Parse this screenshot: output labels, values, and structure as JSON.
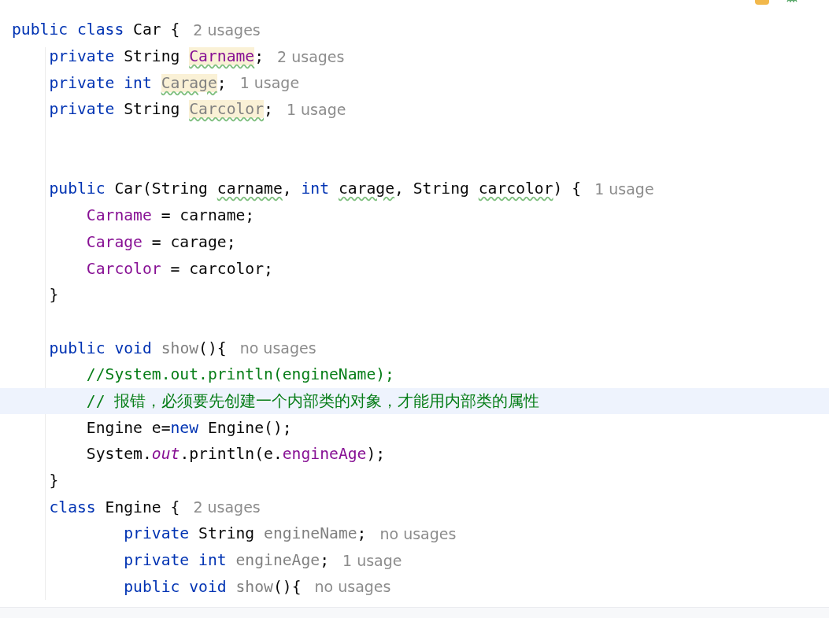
{
  "editor": {
    "lines": [
      {
        "current": false,
        "tokens": [
          {
            "kind": "keyword",
            "text": "public class "
          },
          {
            "kind": "plain",
            "text": "Car {"
          }
        ],
        "hint": "2 usages"
      },
      {
        "current": false,
        "tokens": [
          {
            "kind": "keyword",
            "text": "    private "
          },
          {
            "kind": "plain",
            "text": "String "
          },
          {
            "kind": "field-warn",
            "text": "Carname"
          },
          {
            "kind": "plain",
            "text": ";"
          }
        ],
        "hint": "2 usages"
      },
      {
        "current": false,
        "tokens": [
          {
            "kind": "keyword",
            "text": "    private int "
          },
          {
            "kind": "unused-warn",
            "text": "Carage"
          },
          {
            "kind": "plain",
            "text": ";"
          }
        ],
        "hint": "1 usage"
      },
      {
        "current": false,
        "tokens": [
          {
            "kind": "keyword",
            "text": "    private "
          },
          {
            "kind": "plain",
            "text": "String "
          },
          {
            "kind": "unused-warn",
            "text": "Carcolor"
          },
          {
            "kind": "plain",
            "text": ";"
          }
        ],
        "hint": "1 usage"
      },
      {
        "current": false
      },
      {
        "current": false
      },
      {
        "current": false,
        "tokens": [
          {
            "kind": "keyword",
            "text": "    public "
          },
          {
            "kind": "plain",
            "text": "Car(String "
          },
          {
            "kind": "param",
            "text": "carname"
          },
          {
            "kind": "plain",
            "text": ", "
          },
          {
            "kind": "keyword",
            "text": "int "
          },
          {
            "kind": "param",
            "text": "carage"
          },
          {
            "kind": "plain",
            "text": ", String "
          },
          {
            "kind": "param",
            "text": "carcolor"
          },
          {
            "kind": "plain",
            "text": ") {"
          }
        ],
        "hint": "1 usage"
      },
      {
        "current": false,
        "tokens": [
          {
            "kind": "field",
            "text": "        Carname"
          },
          {
            "kind": "plain",
            "text": " = carname;"
          }
        ]
      },
      {
        "current": false,
        "tokens": [
          {
            "kind": "field",
            "text": "        Carage"
          },
          {
            "kind": "plain",
            "text": " = carage;"
          }
        ]
      },
      {
        "current": false,
        "tokens": [
          {
            "kind": "field",
            "text": "        Carcolor"
          },
          {
            "kind": "plain",
            "text": " = carcolor;"
          }
        ]
      },
      {
        "current": false,
        "tokens": [
          {
            "kind": "plain",
            "text": "    }"
          }
        ]
      },
      {
        "current": false
      },
      {
        "current": false,
        "tokens": [
          {
            "kind": "keyword",
            "text": "    public void "
          },
          {
            "kind": "unused",
            "text": "show"
          },
          {
            "kind": "plain",
            "text": "(){"
          }
        ],
        "hint": "no usages"
      },
      {
        "current": false,
        "tokens": [
          {
            "kind": "comment",
            "text": "        //System.out.println(engineName);"
          }
        ]
      },
      {
        "current": true,
        "tokens": [
          {
            "kind": "comment",
            "text": "        // 报错，必须要先创建一个内部类的对象，才能用内部类的属性"
          }
        ]
      },
      {
        "current": false,
        "tokens": [
          {
            "kind": "plain",
            "text": "        Engine e="
          },
          {
            "kind": "keyword",
            "text": "new "
          },
          {
            "kind": "plain",
            "text": "Engine();"
          }
        ]
      },
      {
        "current": false,
        "tokens": [
          {
            "kind": "plain",
            "text": "        System."
          },
          {
            "kind": "static",
            "text": "out"
          },
          {
            "kind": "plain",
            "text": ".println(e."
          },
          {
            "kind": "field",
            "text": "engineAge"
          },
          {
            "kind": "plain",
            "text": ");"
          }
        ]
      },
      {
        "current": false,
        "tokens": [
          {
            "kind": "plain",
            "text": "    }"
          }
        ]
      },
      {
        "current": false,
        "tokens": [
          {
            "kind": "keyword",
            "text": "    class "
          },
          {
            "kind": "plain",
            "text": "Engine {"
          }
        ],
        "hint": "2 usages"
      },
      {
        "current": false,
        "tokens": [
          {
            "kind": "keyword",
            "text": "            private "
          },
          {
            "kind": "plain",
            "text": "String "
          },
          {
            "kind": "unused",
            "text": "engineName"
          },
          {
            "kind": "plain",
            "text": ";"
          }
        ],
        "hint": "no usages"
      },
      {
        "current": false,
        "tokens": [
          {
            "kind": "keyword",
            "text": "            private int "
          },
          {
            "kind": "unused",
            "text": "engineAge"
          },
          {
            "kind": "plain",
            "text": ";"
          }
        ],
        "hint": "1 usage"
      },
      {
        "current": false,
        "tokens": [
          {
            "kind": "keyword",
            "text": "            public void "
          },
          {
            "kind": "unused",
            "text": "show"
          },
          {
            "kind": "plain",
            "text": "(){"
          }
        ],
        "hint": "no usages"
      }
    ]
  }
}
